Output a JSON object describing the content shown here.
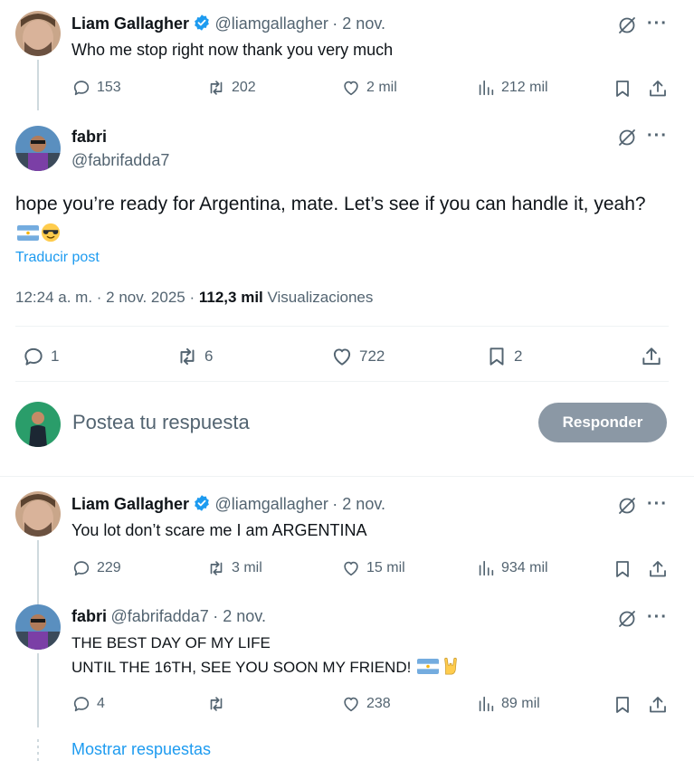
{
  "tweet1": {
    "name": "Liam Gallagher",
    "handle": "@liamgallagher",
    "date": "· 2 nov.",
    "text": "Who me stop right now thank you very much",
    "replies": "153",
    "retweets": "202",
    "likes": "2 mil",
    "views": "212 mil"
  },
  "main_tweet": {
    "name": "fabri",
    "handle": "@fabrifadda7",
    "text": "hope you’re ready for Argentina, mate. Let’s see if you can handle it, yeah?",
    "translate": "Traducir post",
    "time": "12:24 a. m. · 2 nov. 2025 ·",
    "views_count": "112,3 mil",
    "views_label": "Visualizaciones",
    "replies": "1",
    "retweets": "6",
    "likes": "722",
    "bookmarks": "2"
  },
  "reply_box": {
    "placeholder": "Postea tu respuesta",
    "button": "Responder"
  },
  "tweet3": {
    "name": "Liam Gallagher",
    "handle": "@liamgallagher",
    "date": "· 2 nov.",
    "text": "You lot don’t scare me I am ARGENTINA",
    "replies": "229",
    "retweets": "3 mil",
    "likes": "15 mil",
    "views": "934 mil"
  },
  "tweet4": {
    "name": "fabri",
    "handle": "@fabrifadda7",
    "date": "· 2 nov.",
    "line1": "THE BEST DAY OF MY LIFE",
    "line2": "UNTIL THE 16TH, SEE YOU SOON MY FRIEND!",
    "replies": "4",
    "likes": "238",
    "views": "89 mil"
  },
  "show_replies": "Mostrar respuestas",
  "colors": {
    "link": "#1d9bf0",
    "muted": "#536471",
    "button_bg": "#8b98a5",
    "divider": "#eff3f4"
  }
}
